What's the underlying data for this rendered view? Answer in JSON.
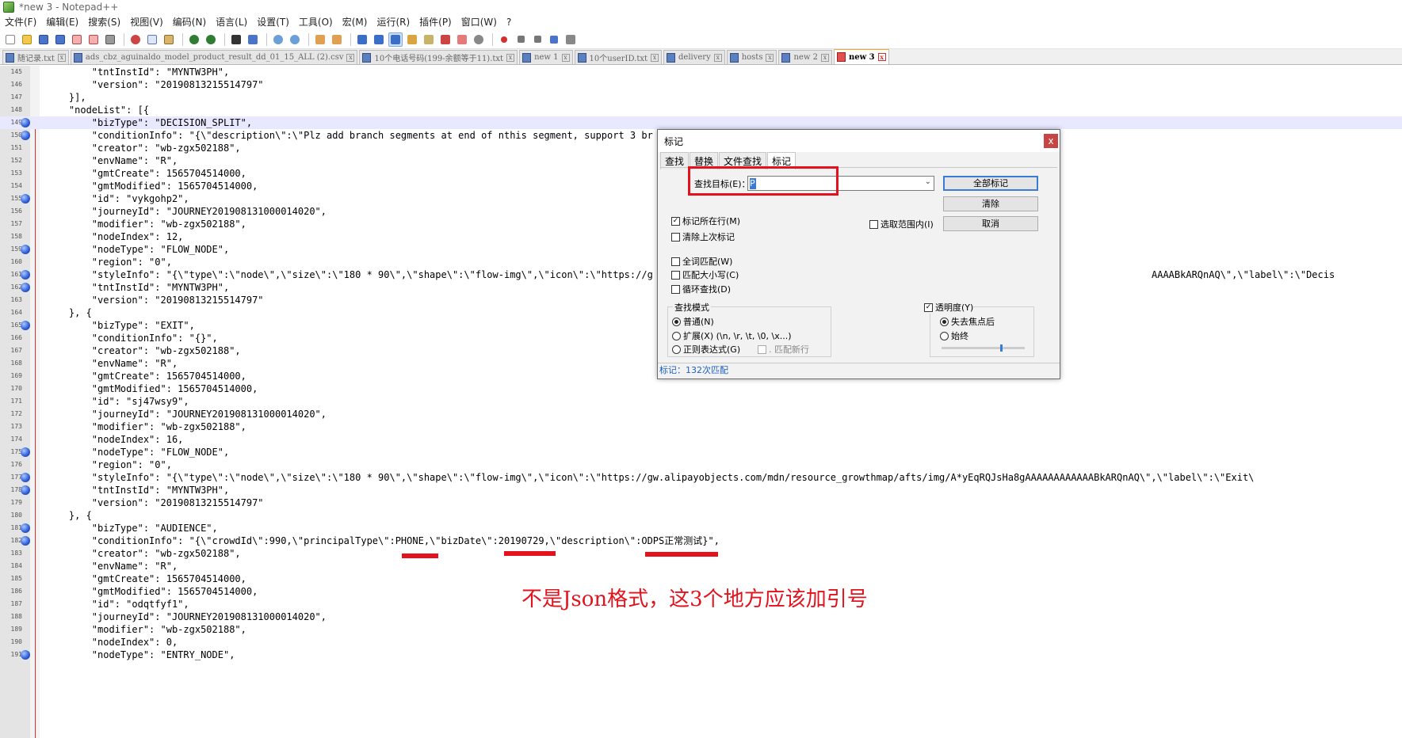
{
  "window": {
    "title": "*new 3 - Notepad++"
  },
  "menu": [
    "文件(F)",
    "编辑(E)",
    "搜索(S)",
    "视图(V)",
    "编码(N)",
    "语言(L)",
    "设置(T)",
    "工具(O)",
    "宏(M)",
    "运行(R)",
    "插件(P)",
    "窗口(W)",
    "?"
  ],
  "tabs": [
    {
      "label": "随记录.txt",
      "active": false
    },
    {
      "label": "ads_cbz_aguinaldo_model_product_result_dd_01_15_ALL (2).csv",
      "active": false
    },
    {
      "label": "10个电话号码(199-余额等于11).txt",
      "active": false
    },
    {
      "label": "new 1",
      "active": false
    },
    {
      "label": "10个userID.txt",
      "active": false
    },
    {
      "label": "delivery",
      "active": false
    },
    {
      "label": "hosts",
      "active": false
    },
    {
      "label": "new 2",
      "active": false
    },
    {
      "label": "new 3",
      "active": true
    }
  ],
  "lines": [
    {
      "n": "145",
      "text": "        \"tntInstId\": \"MYNTW3PH\","
    },
    {
      "n": "146",
      "text": "        \"version\": \"20190813215514797\""
    },
    {
      "n": "147",
      "text": "    }],"
    },
    {
      "n": "148",
      "text": "    \"nodeList\": [{"
    },
    {
      "n": "149",
      "text": "        \"bizType\": \"DECISION_SPLIT\","
    },
    {
      "n": "150",
      "text": "        \"conditionInfo\": \"{\\\"description\\\":\\\"Plz add branch segments at end of nthis segment, support 3 br"
    },
    {
      "n": "151",
      "text": "        \"creator\": \"wb-zgx502188\","
    },
    {
      "n": "152",
      "text": "        \"envName\": \"R\","
    },
    {
      "n": "153",
      "text": "        \"gmtCreate\": 1565704514000,"
    },
    {
      "n": "154",
      "text": "        \"gmtModified\": 1565704514000,"
    },
    {
      "n": "155",
      "text": "        \"id\": \"vykgohp2\","
    },
    {
      "n": "156",
      "text": "        \"journeyId\": \"JOURNEY201908131000014020\","
    },
    {
      "n": "157",
      "text": "        \"modifier\": \"wb-zgx502188\","
    },
    {
      "n": "158",
      "text": "        \"nodeIndex\": 12,"
    },
    {
      "n": "159",
      "text": "        \"nodeType\": \"FLOW_NODE\","
    },
    {
      "n": "160",
      "text": "        \"region\": \"0\","
    },
    {
      "n": "161",
      "text": "        \"styleInfo\": \"{\\\"type\\\":\\\"node\\\",\\\"size\\\":\\\"180 * 90\\\",\\\"shape\\\":\\\"flow-img\\\",\\\"icon\\\":\\\"https://g"
    },
    {
      "n": "162",
      "text": "        \"tntInstId\": \"MYNTW3PH\","
    },
    {
      "n": "163",
      "text": "        \"version\": \"20190813215514797\""
    },
    {
      "n": "164",
      "text": "    }, {"
    },
    {
      "n": "165",
      "text": "        \"bizType\": \"EXIT\","
    },
    {
      "n": "166",
      "text": "        \"conditionInfo\": \"{}\","
    },
    {
      "n": "167",
      "text": "        \"creator\": \"wb-zgx502188\","
    },
    {
      "n": "168",
      "text": "        \"envName\": \"R\","
    },
    {
      "n": "169",
      "text": "        \"gmtCreate\": 1565704514000,"
    },
    {
      "n": "170",
      "text": "        \"gmtModified\": 1565704514000,"
    },
    {
      "n": "171",
      "text": "        \"id\": \"sj47wsy9\","
    },
    {
      "n": "172",
      "text": "        \"journeyId\": \"JOURNEY201908131000014020\","
    },
    {
      "n": "173",
      "text": "        \"modifier\": \"wb-zgx502188\","
    },
    {
      "n": "174",
      "text": "        \"nodeIndex\": 16,"
    },
    {
      "n": "175",
      "text": "        \"nodeType\": \"FLOW_NODE\","
    },
    {
      "n": "176",
      "text": "        \"region\": \"0\","
    },
    {
      "n": "177",
      "text": "        \"styleInfo\": \"{\\\"type\\\":\\\"node\\\",\\\"size\\\":\\\"180 * 90\\\",\\\"shape\\\":\\\"flow-img\\\",\\\"icon\\\":\\\"https://gw.alipayobjects.com/mdn/resource_growthmap/afts/img/A*yEqRQJsHa8gAAAAAAAAAAAABkARQnAQ\\\",\\\"label\\\":\\\"Exit\\"
    },
    {
      "n": "178",
      "text": "        \"tntInstId\": \"MYNTW3PH\","
    },
    {
      "n": "179",
      "text": "        \"version\": \"20190813215514797\""
    },
    {
      "n": "180",
      "text": "    }, {"
    },
    {
      "n": "181",
      "text": "        \"bizType\": \"AUDIENCE\","
    },
    {
      "n": "182",
      "text": "        \"conditionInfo\": \"{\\\"crowdId\\\":990,\\\"principalType\\\":PHONE,\\\"bizDate\\\":20190729,\\\"description\\\":ODPS正常测试}\","
    },
    {
      "n": "183",
      "text": "        \"creator\": \"wb-zgx502188\","
    },
    {
      "n": "184",
      "text": "        \"envName\": \"R\","
    },
    {
      "n": "185",
      "text": "        \"gmtCreate\": 1565704514000,"
    },
    {
      "n": "186",
      "text": "        \"gmtModified\": 1565704514000,"
    },
    {
      "n": "187",
      "text": "        \"id\": \"odqtfyf1\","
    },
    {
      "n": "188",
      "text": "        \"journeyId\": \"JOURNEY201908131000014020\","
    },
    {
      "n": "189",
      "text": "        \"modifier\": \"wb-zgx502188\","
    },
    {
      "n": "190",
      "text": "        \"nodeIndex\": 0,"
    },
    {
      "n": "191",
      "text": "        \"nodeType\": \"ENTRY_NODE\","
    }
  ],
  "line161_tail": "AAAABkARQnAQ\\\",\\\"label\\\":\\\"Decis",
  "annotation": "不是Json格式，这3个地方应该加引号",
  "dialog": {
    "title": "标记",
    "close": "x",
    "tabs": [
      "查找",
      "替换",
      "文件查找",
      "标记"
    ],
    "find_label": "查找目标(E)：",
    "find_value": "P",
    "btn_mark_all": "全部标记",
    "btn_clear": "清除",
    "btn_cancel": "取消",
    "chk_bookmark": "标记所在行(M)",
    "chk_purge": "清除上次标记",
    "chk_in_selection": "选取范围内(I)",
    "chk_whole_word": "全词匹配(W)",
    "chk_match_case": "匹配大小写(C)",
    "chk_wrap": "循环查找(D)",
    "mode_title": "查找模式",
    "mode_normal": "普通(N)",
    "mode_extended": "扩展(X) (\\n, \\r, \\t, \\0, \\x...)",
    "mode_regex": "正则表达式(G)",
    "mode_dot_newline": ". 匹配新行",
    "transparency": "透明度(Y)",
    "trans_on_lose_focus": "失去焦点后",
    "trans_always": "始终",
    "status": "标记：132次匹配"
  },
  "colors": {
    "annotation_red": "#e3121c",
    "bookmark_blue": "#2b59d6",
    "numeric": "#c21f1f"
  }
}
